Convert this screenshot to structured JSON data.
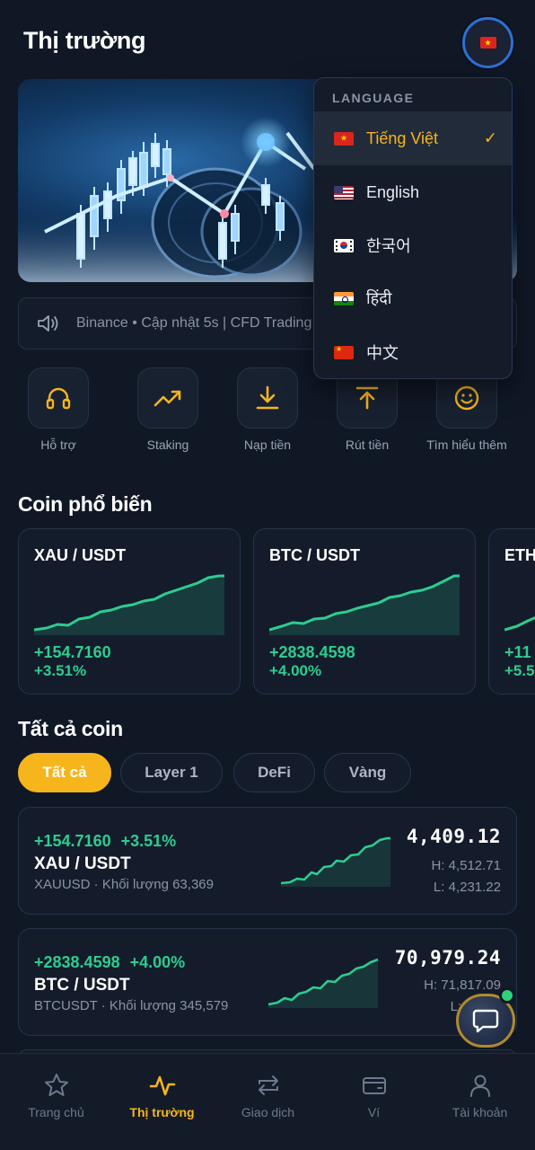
{
  "header": {
    "title": "Thị trường",
    "language_flag_icon": "vietnam-flag-icon"
  },
  "ticker": {
    "text": "Binance • Cập nhật 5s | CFD Trading"
  },
  "actions": [
    {
      "label": "Hỗ trợ",
      "icon": "headphones-icon"
    },
    {
      "label": "Staking",
      "icon": "trend-up-icon"
    },
    {
      "label": "Nạp tiền",
      "icon": "download-icon"
    },
    {
      "label": "Rút tiền",
      "icon": "upload-icon"
    },
    {
      "label": "Tìm hiểu thêm",
      "icon": "smile-icon"
    }
  ],
  "popular": {
    "title": "Coin phổ biến",
    "cards": [
      {
        "pair": "XAU / USDT",
        "change": "+154.7160",
        "percent": "+3.51%"
      },
      {
        "pair": "BTC / USDT",
        "change": "+2838.4598",
        "percent": "+4.00%"
      },
      {
        "pair": "ETH",
        "change": "+11",
        "percent": "+5.5"
      }
    ]
  },
  "all_coins": {
    "title": "Tất cả coin",
    "filters": [
      "Tất cả",
      "Layer 1",
      "DeFi",
      "Vàng"
    ],
    "active_filter": "Tất cả",
    "rows": [
      {
        "change": "+154.7160",
        "percent": "+3.51%",
        "pair": "XAU / USDT",
        "sub": "XAUUSD · Khối lượng 63,369",
        "price": "4,409.12",
        "high": "H: 4,512.71",
        "low": "L: 4,231.22"
      },
      {
        "change": "+2838.4598",
        "percent": "+4.00%",
        "pair": "BTC / USDT",
        "sub": "BTCUSDT · Khối lượng 345,579",
        "price": "70,979.24",
        "high": "H: 71,817.09",
        "low": "L: 67"
      }
    ]
  },
  "bottom_nav": [
    {
      "label": "Trang chủ",
      "icon": "star-icon",
      "active": false
    },
    {
      "label": "Thị trường",
      "icon": "activity-icon",
      "active": true
    },
    {
      "label": "Giao dịch",
      "icon": "swap-icon",
      "active": false
    },
    {
      "label": "Ví",
      "icon": "wallet-icon",
      "active": false
    },
    {
      "label": "Tài khoản",
      "icon": "user-icon",
      "active": false
    }
  ],
  "language_menu": {
    "heading": "LANGUAGE",
    "items": [
      {
        "label": "Tiếng Việt",
        "flag": "vietnam-flag-icon",
        "selected": true
      },
      {
        "label": "English",
        "flag": "usa-flag-icon",
        "selected": false
      },
      {
        "label": "한국어",
        "flag": "korea-flag-icon",
        "selected": false
      },
      {
        "label": "हिंदी",
        "flag": "india-flag-icon",
        "selected": false
      },
      {
        "label": "中文",
        "flag": "china-flag-icon",
        "selected": false
      }
    ],
    "check_mark": "✓"
  },
  "colors": {
    "accent": "#f7b51c",
    "positive": "#2ecc8f",
    "background": "#101826",
    "card": "#141c2b"
  }
}
